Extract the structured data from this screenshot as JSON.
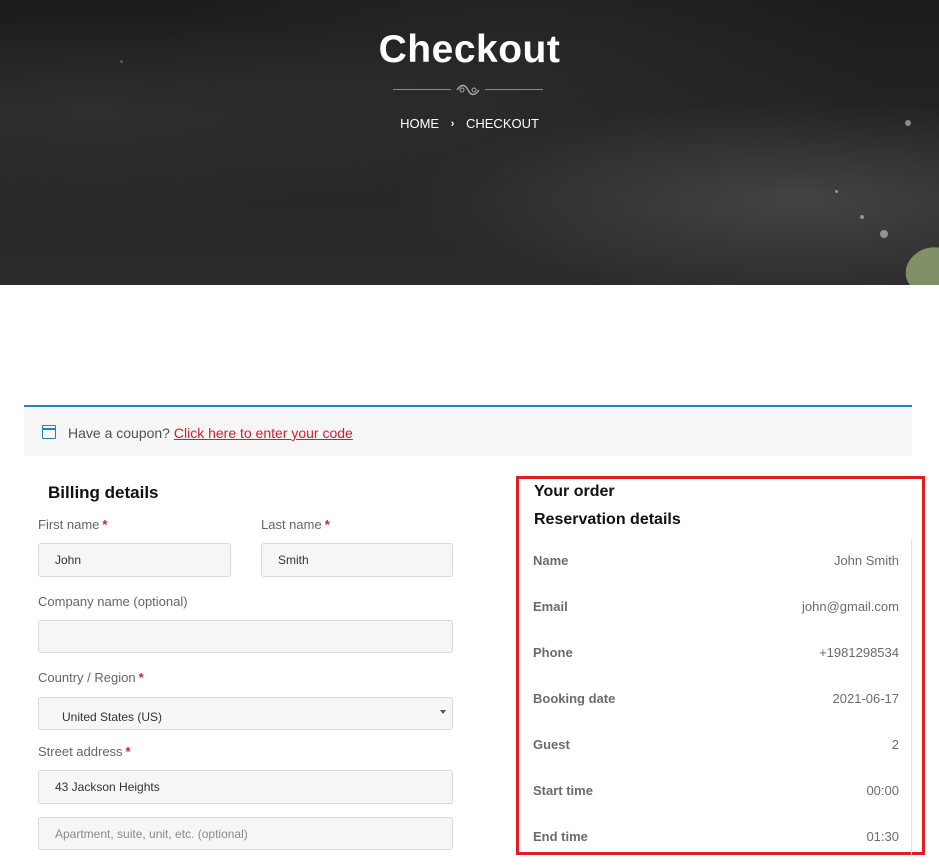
{
  "hero": {
    "title": "Checkout",
    "breadcrumb": {
      "home": "HOME",
      "separator": "›",
      "current": "CHECKOUT"
    }
  },
  "coupon": {
    "prompt": "Have a coupon?",
    "link": "Click here to enter your code"
  },
  "billing": {
    "title": "Billing details",
    "required_mark": "*",
    "first_name": {
      "label": "First name",
      "value": "John"
    },
    "last_name": {
      "label": "Last name",
      "value": "Smith"
    },
    "company": {
      "label": "Company name (optional)",
      "value": ""
    },
    "country": {
      "label": "Country / Region",
      "value": "United States (US)"
    },
    "street": {
      "label": "Street address",
      "value": "43 Jackson Heights"
    },
    "apartment": {
      "placeholder": "Apartment, suite, unit, etc. (optional)"
    }
  },
  "order": {
    "title": "Your order",
    "reservation_title": "Reservation details",
    "rows": [
      {
        "label": "Name",
        "value": "John Smith"
      },
      {
        "label": "Email",
        "value": "john@gmail.com"
      },
      {
        "label": "Phone",
        "value": "+1981298534"
      },
      {
        "label": "Booking date",
        "value": "2021-06-17"
      },
      {
        "label": "Guest",
        "value": "2"
      },
      {
        "label": "Start time",
        "value": "00:00"
      },
      {
        "label": "End time",
        "value": "01:30"
      }
    ]
  },
  "colors": {
    "accent_red": "#d0202e",
    "highlight_frame": "#e21b25",
    "coupon_border": "#1e85be"
  }
}
